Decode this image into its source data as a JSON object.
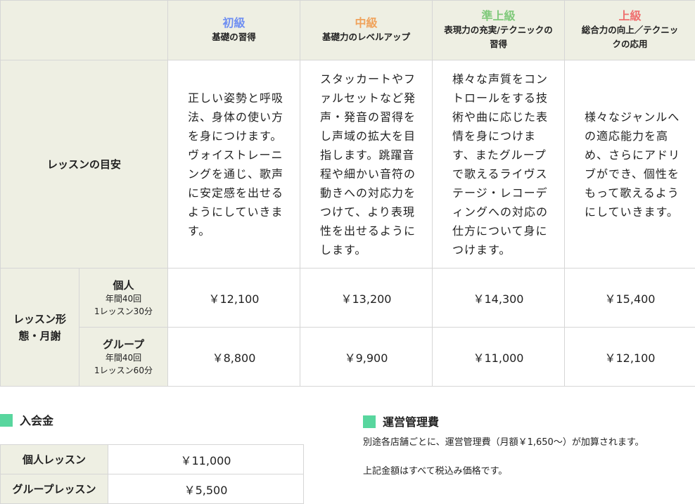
{
  "levels": [
    {
      "name": "初級",
      "sub": "基礎の習得",
      "color": "#6f8ff2"
    },
    {
      "name": "中級",
      "sub": "基礎力のレベルアップ",
      "color": "#f0a35c"
    },
    {
      "name": "準上級",
      "sub": "表現力の充実/テクニックの習得",
      "color": "#7fc97a"
    },
    {
      "name": "上級",
      "sub": "総合力の向上／テクニックの応用",
      "color": "#ef6f6f"
    }
  ],
  "guide": {
    "label": "レッスンの目安",
    "descs": [
      "正しい姿勢と呼吸法、身体の使い方を身につけます。ヴォイストレーニングを通じ、歌声に安定感を出せるようにしていきます。",
      "スタッカートやファルセットなど発声・発音の習得をし声域の拡大を目指します。跳躍音程や細かい音符の動きへの対応力をつけて、より表現性を出せるようにします。",
      "様々な声質をコントロールをする技術や曲に応じた表情を身につけます、またグループで歌えるライヴステージ・レコーディングへの対応の仕方について身につけます。",
      "様々なジャンルへの適応能力を高め、さらにアドリブができ、個性をもって歌えるようにしていきます。"
    ]
  },
  "lessons": {
    "label": "レッスン形態・月謝",
    "rows": [
      {
        "name": "個人",
        "detail1": "年間40回",
        "detail2": "1レッスン30分",
        "prices": [
          "￥12,100",
          "￥13,200",
          "￥14,300",
          "￥15,400"
        ]
      },
      {
        "name": "グループ",
        "detail1": "年間40回",
        "detail2": "1レッスン60分",
        "prices": [
          "￥8,800",
          "￥9,900",
          "￥11,000",
          "￥12,100"
        ]
      }
    ]
  },
  "admission": {
    "title": "入会金",
    "rows": [
      {
        "label": "個人レッスン",
        "value": "￥11,000"
      },
      {
        "label": "グループレッスン",
        "value": "￥5,500"
      }
    ]
  },
  "management": {
    "title": "運営管理費",
    "note1": "別途各店舗ごとに、運営管理費（月額￥1,650～）が加算されます。",
    "note2": "上記金額はすべて税込み価格です。"
  },
  "colors": {
    "accent": "#58d69e",
    "header_bg": "#eeefe3",
    "border": "#d6d6d6"
  }
}
